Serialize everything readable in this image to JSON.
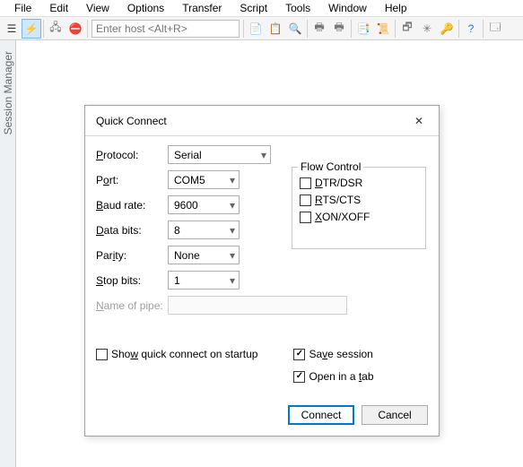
{
  "menubar": {
    "items": [
      "File",
      "Edit",
      "View",
      "Options",
      "Transfer",
      "Script",
      "Tools",
      "Window",
      "Help"
    ]
  },
  "toolbar": {
    "host_placeholder": "Enter host <Alt+R>"
  },
  "session_manager": {
    "label": "Session Manager"
  },
  "dialog": {
    "title": "Quick Connect",
    "labels": {
      "protocol": "Protocol:",
      "port": "Port:",
      "baud": "Baud rate:",
      "databits": "Data bits:",
      "parity": "Parity:",
      "stopbits": "Stop bits:",
      "pipe": "Name of pipe:"
    },
    "underline": {
      "protocol": "P",
      "port": "o",
      "baud": "B",
      "databits": "D",
      "parity": "i",
      "stopbits": "S",
      "pipe": "N"
    },
    "values": {
      "protocol": "Serial",
      "port": "COM5",
      "baud": "9600",
      "databits": "8",
      "parity": "None",
      "stopbits": "1"
    },
    "flow_control": {
      "legend": "Flow Control",
      "dtr": "DTR/DSR",
      "rts": "RTS/CTS",
      "xon": "XON/XOFF",
      "dtr_checked": false,
      "rts_checked": false,
      "xon_checked": false
    },
    "checks": {
      "show_on_startup": "Show quick connect on startup",
      "save_session": "Save session",
      "open_in_tab": "Open in a tab",
      "show_on_startup_checked": false,
      "save_session_checked": true,
      "open_in_tab_checked": true
    },
    "buttons": {
      "connect": "Connect",
      "cancel": "Cancel"
    }
  }
}
